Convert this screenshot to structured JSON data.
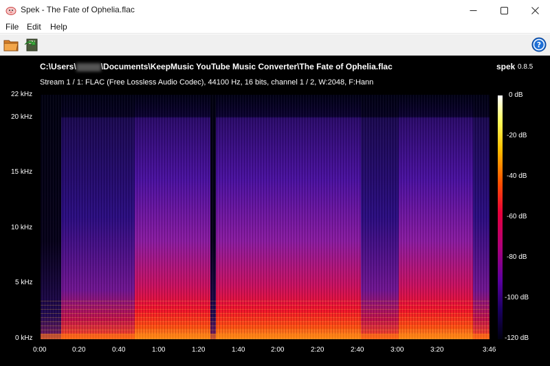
{
  "window": {
    "title": "Spek - The Fate of Ophelia.flac"
  },
  "menu": {
    "items": [
      "File",
      "Edit",
      "Help"
    ]
  },
  "toolbar": {
    "icons": [
      "open-folder-icon",
      "save-icon",
      "help-icon"
    ]
  },
  "spectrogram": {
    "file_path_prefix": "C:\\Users\\",
    "file_path_suffix": "\\Documents\\KeepMusic YouTube Music Converter\\The Fate of Ophelia.flac",
    "app_name": "spek",
    "app_version": "0.8.5",
    "stream_info": "Stream 1 / 1: FLAC (Free Lossless Audio Codec), 44100 Hz, 16 bits, channel 1 / 2, W:2048, F:Hann",
    "freq_labels": [
      "22 kHz",
      "20 kHz",
      "15 kHz",
      "10 kHz",
      "5 kHz",
      "0 kHz"
    ],
    "time_labels": [
      "0:00",
      "0:20",
      "0:40",
      "1:00",
      "1:20",
      "1:40",
      "2:00",
      "2:20",
      "2:40",
      "3:00",
      "3:20",
      "3:46"
    ],
    "db_labels": [
      "0 dB",
      "-20 dB",
      "-40 dB",
      "-60 dB",
      "-80 dB",
      "-100 dB",
      "-120 dB"
    ]
  },
  "colors": {
    "background": "#000000",
    "text": "#ffffff",
    "accent_help": "#1e6fd6"
  }
}
